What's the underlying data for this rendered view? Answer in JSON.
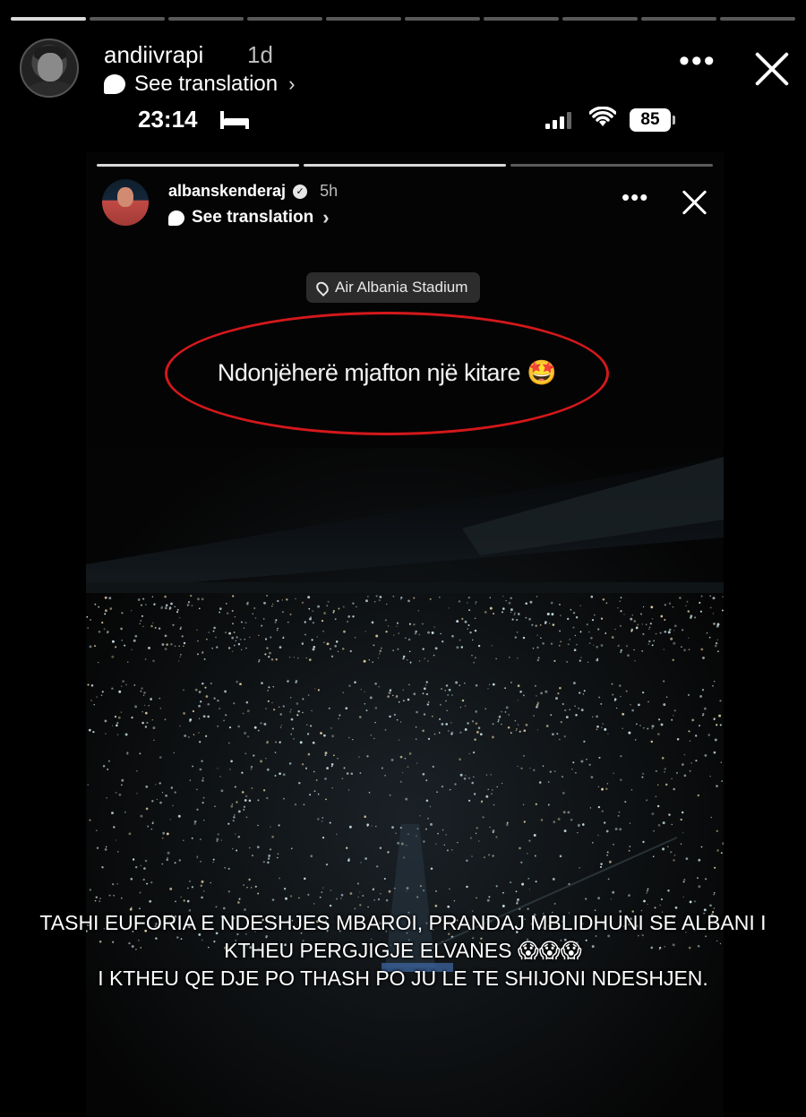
{
  "outer_story": {
    "username": "andiivrapi",
    "time_ago": "1d",
    "translate_label": "See translation",
    "progress_total": 10,
    "progress_done": 1
  },
  "status_bar": {
    "time": "23:14",
    "battery": "85"
  },
  "inner_story": {
    "username": "albanskenderaj",
    "time_ago": "5h",
    "translate_label": "See translation",
    "location": "Air Albania Stadium",
    "caption": "Ndonjëherë mjafton një kitare 🤩",
    "progress_total": 3,
    "progress_done": 2
  },
  "overlay_text": {
    "line1": "TASHI EUFORIA E NDESHJES  MBAROI, PRANDAJ MBLIDHUNI SE ALBANI I",
    "line2": "KTHEU PERGJIGJE ELVANES 😱😱😱",
    "line3": "I KTHEU QE DJE PO THASH PO JU LE TE SHIJONI NDESHJEN."
  },
  "colors": {
    "highlight_ring": "#d4181b",
    "background": "#000000"
  }
}
